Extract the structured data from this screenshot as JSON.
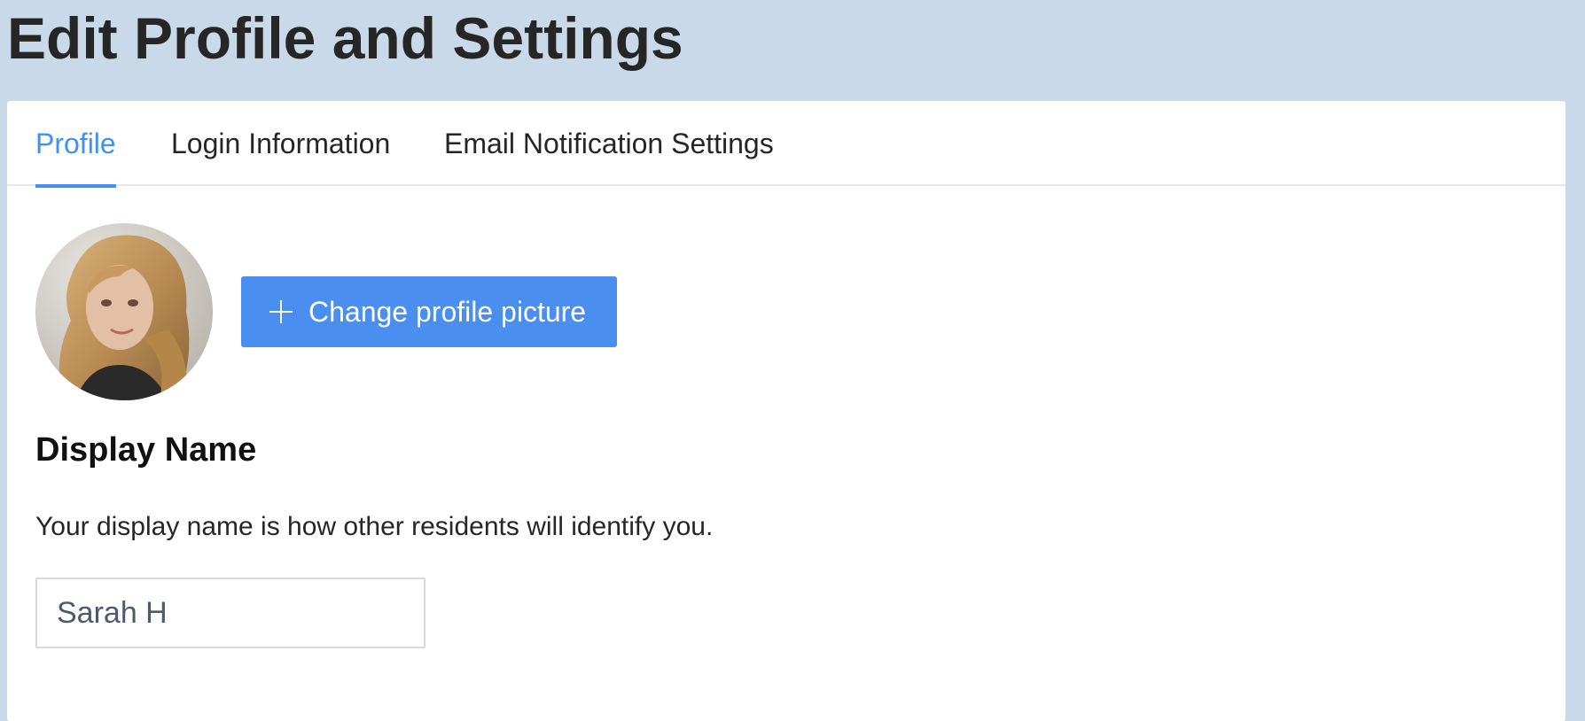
{
  "page": {
    "title": "Edit Profile and Settings"
  },
  "tabs": [
    {
      "label": "Profile",
      "active": true
    },
    {
      "label": "Login Information",
      "active": false
    },
    {
      "label": "Email Notification Settings",
      "active": false
    }
  ],
  "profile": {
    "avatar_icon": "user-photo",
    "change_picture_label": "Change profile picture",
    "change_picture_icon": "plus-icon"
  },
  "display_name": {
    "heading": "Display Name",
    "description": "Your display name is how other residents will identify you.",
    "value": "Sarah H",
    "placeholder": ""
  },
  "colors": {
    "background": "#c9d9e9",
    "accent": "#4390ef",
    "button": "#4a8ff0"
  }
}
